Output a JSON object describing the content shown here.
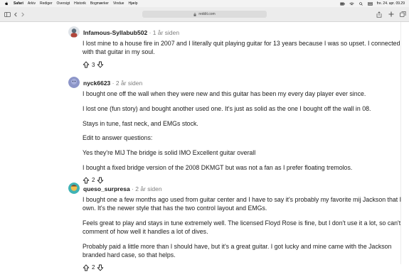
{
  "menubar": {
    "items": [
      "Safari",
      "Arkiv",
      "Rediger",
      "Oversigt",
      "Historik",
      "Bogmærker",
      "Vindue",
      "Hjælp"
    ],
    "clock": "fre. 24. apr. 09.29"
  },
  "toolbar": {
    "url": "reddit.com"
  },
  "comments": [
    {
      "author": "Infamous-Syllabub502",
      "age": "· 1 år siden",
      "paragraphs": [
        "I lost mine to a house fire in 2007 and I literally quit playing guitar for 13 years because I was so upset. I connected with that guitar in my soul."
      ],
      "votes": "3",
      "avatar_color": "#5b6c7a"
    },
    {
      "author": "nyck6623",
      "age": "· 2 år siden",
      "paragraphs": [
        "I bought one off the wall when they were new and this guitar has been my every day player ever since.",
        "I lost one (fun story) and bought another used one. It's just as solid as the one I bought off the wall in 08.",
        "Stays in tune, fast neck, and EMGs stock.",
        "Edit to answer questions:",
        "Yes they're MIJ The bridge is solid IMO Excellent guitar overall",
        "I bought a fixed bridge version of the 2008 DKMGT but was not a fan as I prefer floating tremolos."
      ],
      "votes": "2",
      "avatar_color": "#8c95c8"
    },
    {
      "author": "queso_surpresa",
      "age": "· 2 år siden",
      "paragraphs": [
        "I bought one a few months ago used from guitar center and I have to say it's probably my favorite mij Jackson that I own. It's the newer style that has the two control layout and EMGs.",
        "Feels great to play and stays in tune extremely well. The licensed Floyd Rose is fine, but I don't use it a lot, so can't comment of how well it handles a lot of dives.",
        "Probably paid a little more than I should have, but it's a great guitar. I got lucky and mine came with the Jackson branded hard case, so that helps."
      ],
      "votes": "2",
      "avatar_color": "#3fb3b5"
    }
  ]
}
